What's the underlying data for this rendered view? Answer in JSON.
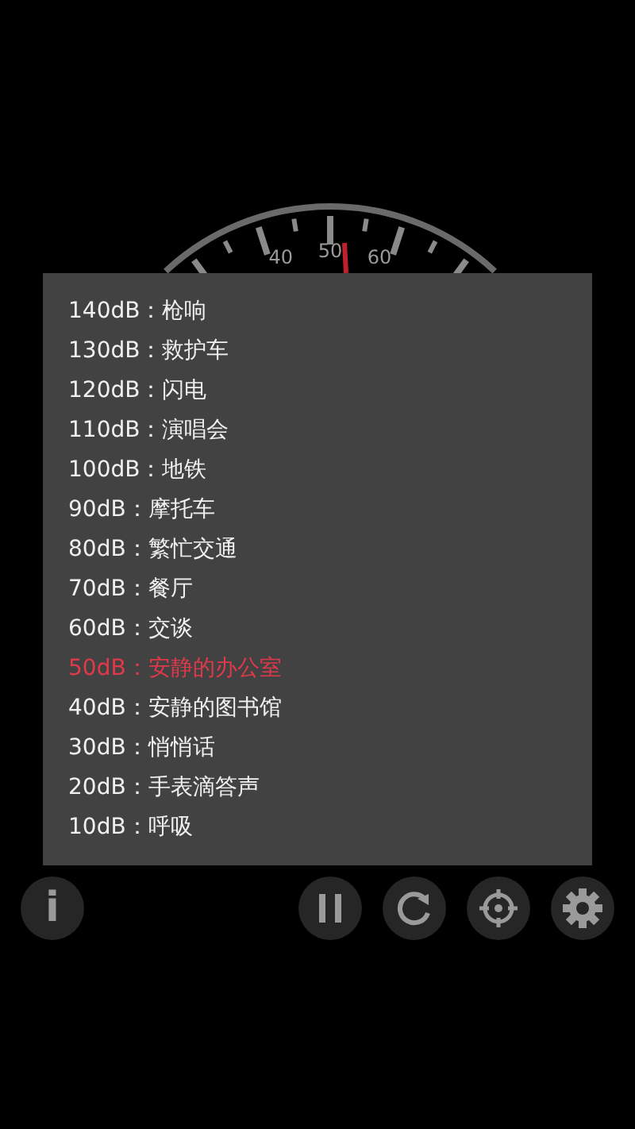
{
  "gauge": {
    "labels": [
      "40",
      "50",
      "60"
    ]
  },
  "dialog": {
    "items": [
      {
        "text": "140dB：枪响",
        "highlighted": false
      },
      {
        "text": "130dB：救护车",
        "highlighted": false
      },
      {
        "text": "120dB：闪电",
        "highlighted": false
      },
      {
        "text": "110dB：演唱会",
        "highlighted": false
      },
      {
        "text": "100dB：地铁",
        "highlighted": false
      },
      {
        "text": "90dB：摩托车",
        "highlighted": false
      },
      {
        "text": "80dB：繁忙交通",
        "highlighted": false
      },
      {
        "text": "70dB：餐厅",
        "highlighted": false
      },
      {
        "text": "60dB：交谈",
        "highlighted": false
      },
      {
        "text": "50dB：安静的办公室",
        "highlighted": true
      },
      {
        "text": "40dB：安静的图书馆",
        "highlighted": false
      },
      {
        "text": "30dB：悄悄话",
        "highlighted": false
      },
      {
        "text": "20dB：手表滴答声",
        "highlighted": false
      },
      {
        "text": "10dB：呼吸",
        "highlighted": false
      }
    ]
  },
  "buttons": [
    {
      "kind": "info",
      "text": "i"
    },
    {
      "kind": "pause"
    },
    {
      "kind": "refresh"
    },
    {
      "kind": "target"
    },
    {
      "kind": "settings"
    }
  ]
}
